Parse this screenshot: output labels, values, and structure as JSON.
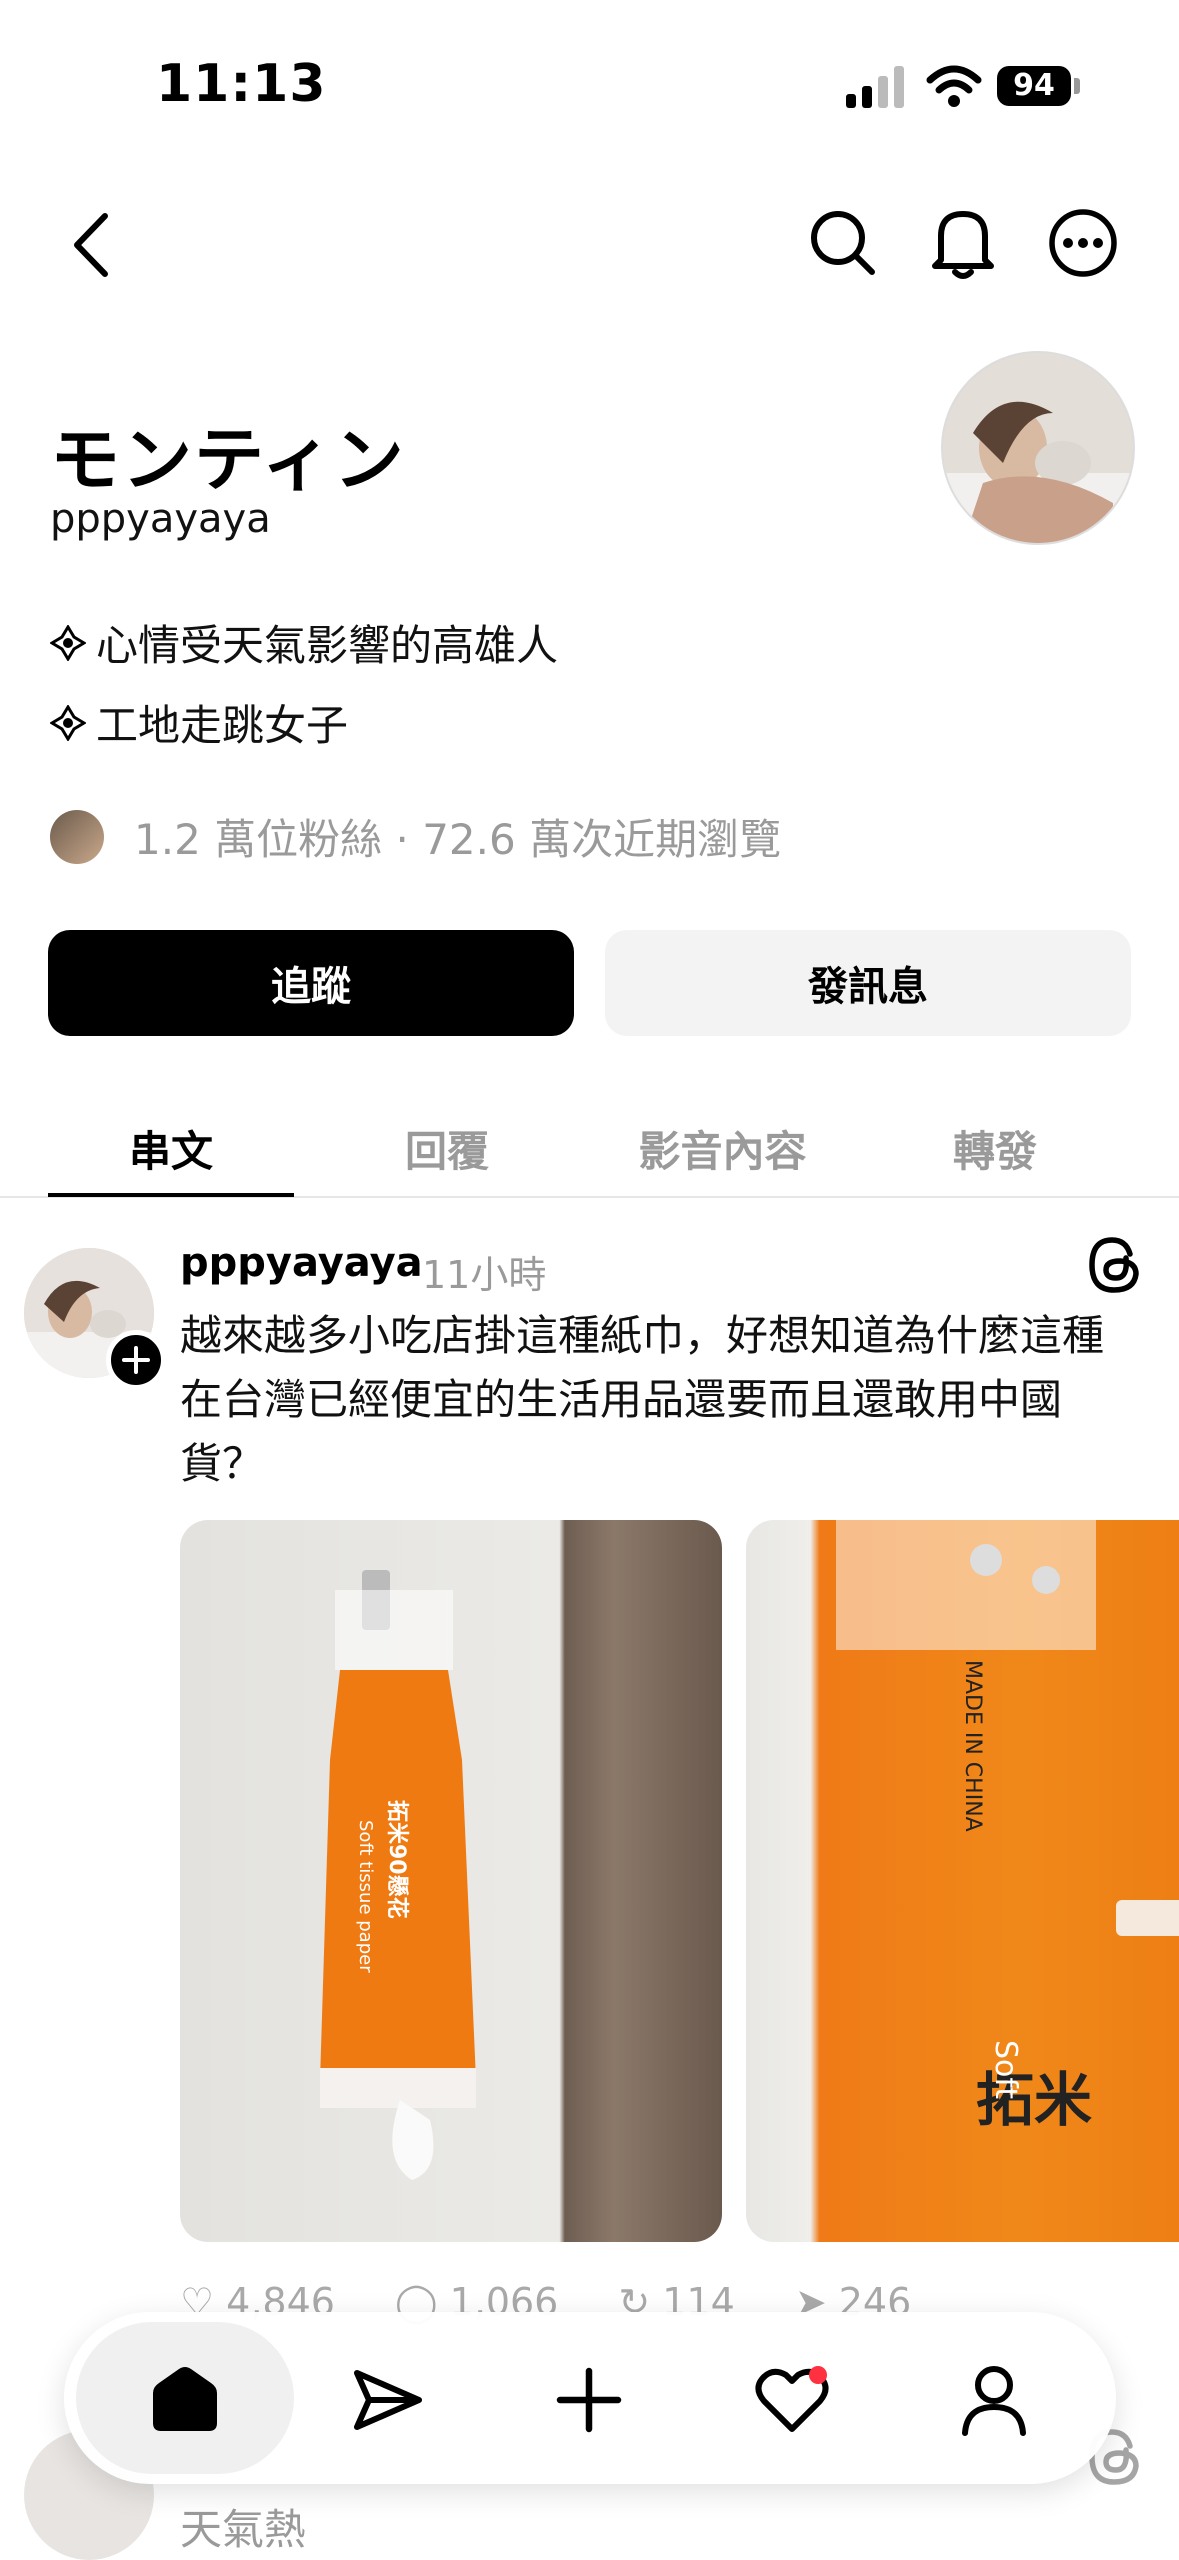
{
  "status_bar": {
    "time": "11:13",
    "battery": "94"
  },
  "header": {
    "back_icon": "chevron-left-icon",
    "search_icon": "search-icon",
    "bell_icon": "bell-icon",
    "more_icon": "more-icon"
  },
  "profile": {
    "name": "モンティン",
    "handle": "pppyayaya",
    "bio": [
      "心情受天氣影響的高雄人",
      "工地走跳女子"
    ],
    "stats": "1.2 萬位粉絲 · 72.6 萬次近期瀏覽"
  },
  "actions": {
    "follow": "追蹤",
    "message": "發訊息"
  },
  "tabs": [
    {
      "label": "串文",
      "active": true
    },
    {
      "label": "回覆",
      "active": false
    },
    {
      "label": "影音內容",
      "active": false
    },
    {
      "label": "轉發",
      "active": false
    }
  ],
  "post": {
    "username": "pppyayaya",
    "time": "11小時",
    "text": "越來越多小吃店掛這種紙巾，好想知道為什麼這種在台灣已經便宜的生活用品還要而且還敢用中國貨？",
    "image1": {
      "brand": "拓米90懸花",
      "side_text": "Soft tissue paper"
    },
    "image2": {
      "brand": "拓米",
      "made_in": "MADE IN CHINA",
      "side_text": "Soft"
    },
    "counts": {
      "likes": "4,846",
      "comments": "1,066",
      "reposts": "114",
      "shares": "246"
    }
  },
  "next_post": {
    "preview_text": "天氣熱"
  },
  "nav": {
    "items": [
      "home-icon",
      "send-icon",
      "plus-icon",
      "heart-icon",
      "profile-icon"
    ],
    "accent": "#ff3040"
  }
}
